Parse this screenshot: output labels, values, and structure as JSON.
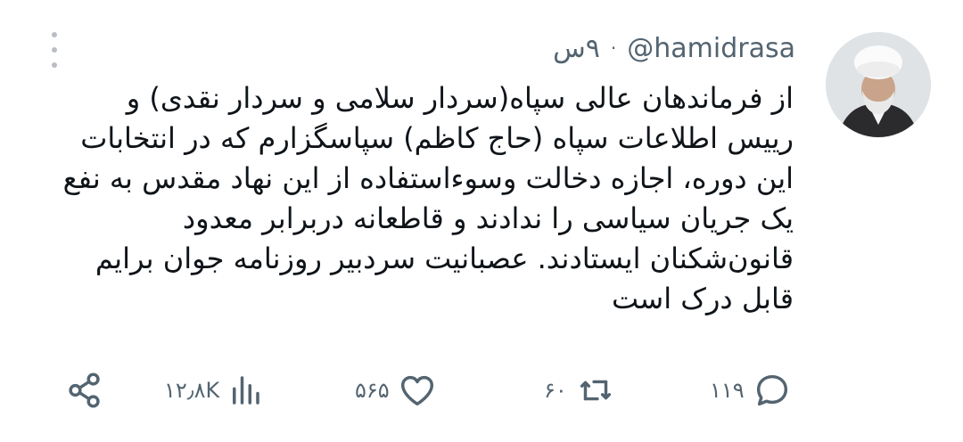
{
  "tweet": {
    "handle": "@hamidrasa",
    "separator": "·",
    "time": "۹س",
    "lines": [
      "از فرماندهان عالی سپاه(سردار سلامی و سردار نقدی) و",
      "رییس اطلاعات سپاه (حاج کاظم) سپاسگزارم که در انتخابات",
      "این دوره، اجازه دخالت وسوءاستفاده از این نهاد مقدس به نفع",
      "یک جریان سیاسی را ندادند و قاطعانه دربرابر معدود",
      "قانون‌شکنان ایستادند. عصبانیت سردبیر روزنامه جوان برایم",
      "قابل درک است"
    ]
  },
  "actions": {
    "replies": "۱۱۹",
    "retweets": "۶۰",
    "likes": "۵۶۵",
    "views": "۱۲٫۸K"
  },
  "icons": {
    "avatar": "avatar-photo",
    "more": "more-vertical-icon",
    "reply": "reply-icon",
    "retweet": "retweet-icon",
    "like": "heart-icon",
    "views": "views-icon",
    "share": "share-icon"
  },
  "colors": {
    "text": "#0f1419",
    "muted": "#536471",
    "icon": "#536471"
  }
}
